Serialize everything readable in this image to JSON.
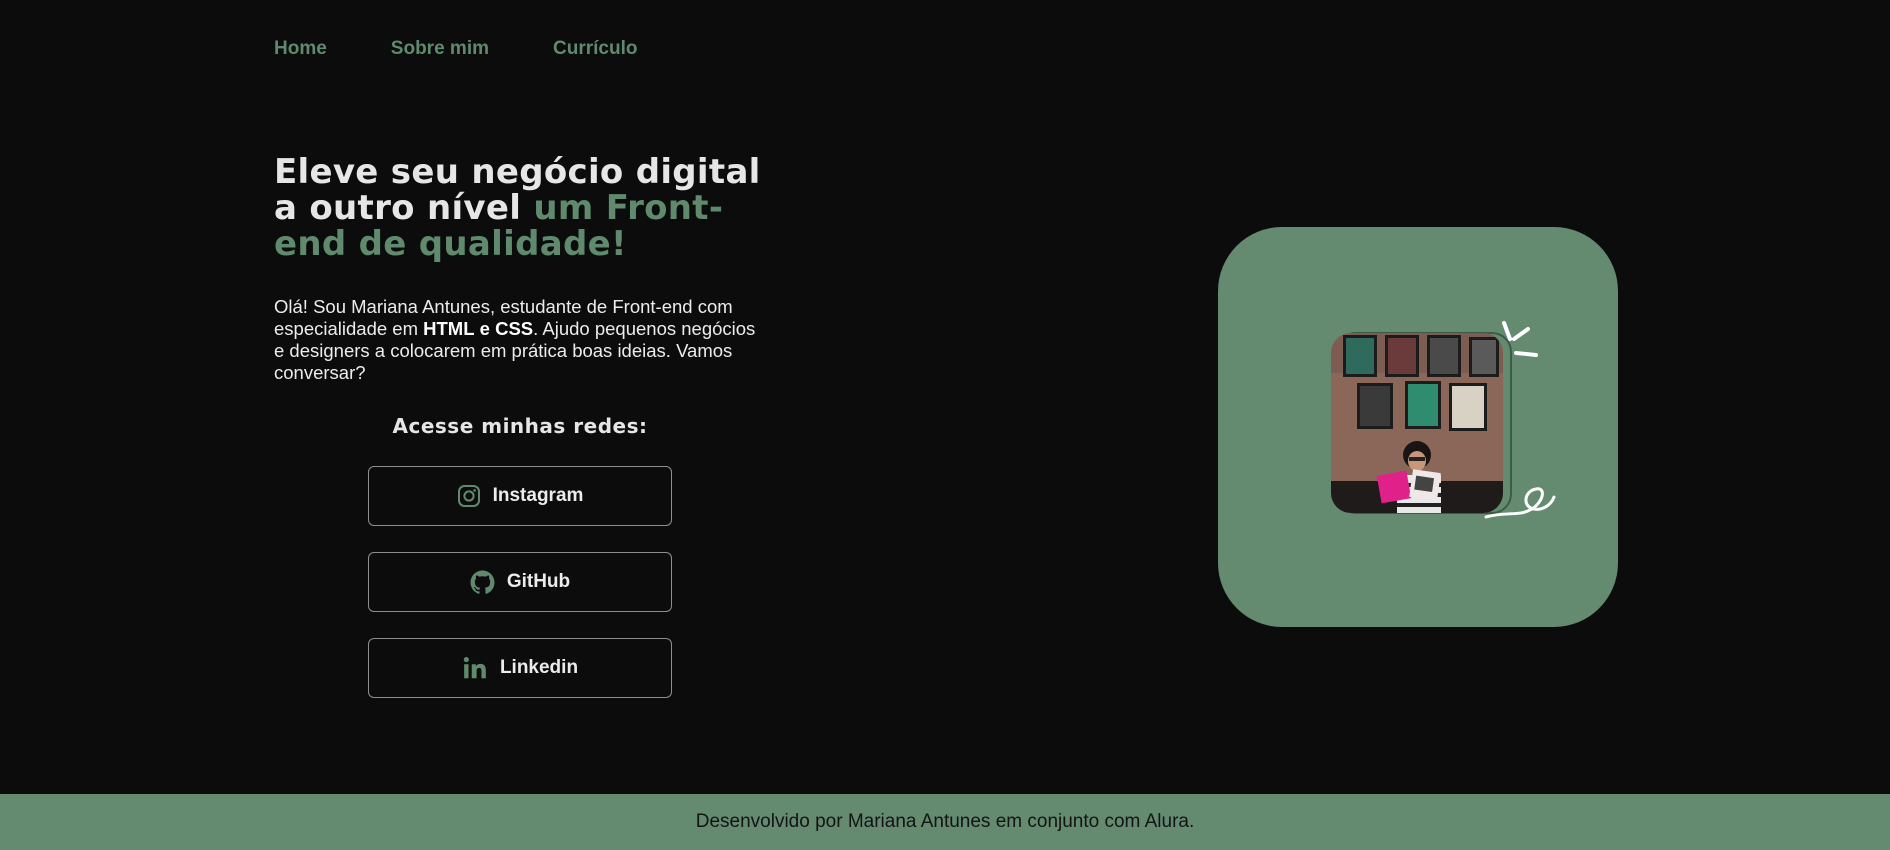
{
  "nav": {
    "items": [
      {
        "label": "Home"
      },
      {
        "label": "Sobre mim"
      },
      {
        "label": "Currículo"
      }
    ]
  },
  "hero": {
    "title_part1": "Eleve seu negócio digital a outro nível",
    "title_accent": "um Front-end de qualidade!",
    "intro_before": "Olá! Sou Mariana Antunes, estudante de Front-end com especialidade em",
    "intro_html": "HTML",
    "intro_and": "e",
    "intro_css": "CSS",
    "intro_after": ". Ajudo pequenos negócios e designers a colocarem em prática boas ideias. Vamos conversar?"
  },
  "social": {
    "title": "Acesse minhas redes:",
    "buttons": [
      {
        "label": "Instagram",
        "icon": "instagram-icon"
      },
      {
        "label": "GitHub",
        "icon": "github-icon"
      },
      {
        "label": "Linkedin",
        "icon": "linkedin-icon"
      }
    ]
  },
  "footer": {
    "text": "Desenvolvido por Mariana Antunes em conjunto com Alura."
  },
  "colors": {
    "background": "#0c0c0c",
    "accent": "#648a70",
    "nav_text": "#5f8a6d",
    "text": "#e6e6e6"
  }
}
